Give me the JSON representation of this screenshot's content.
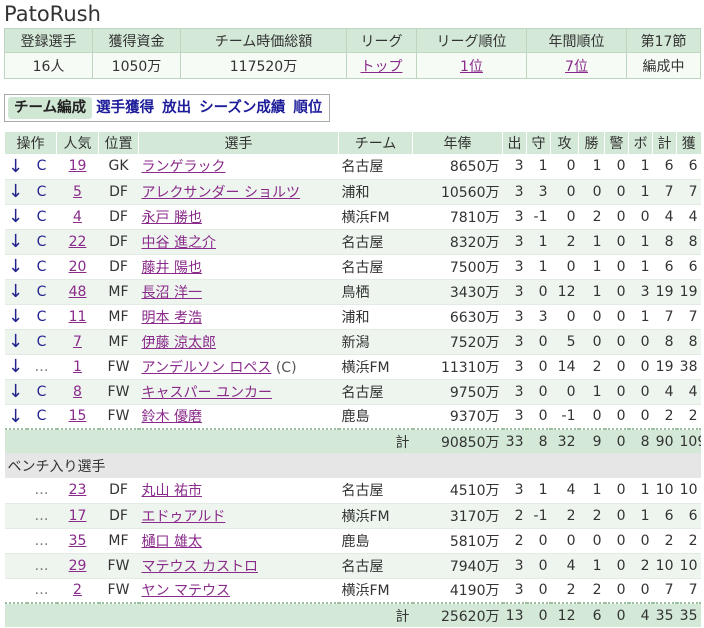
{
  "team": {
    "name": "PatoRush"
  },
  "summary": {
    "headers": [
      "登録選手",
      "獲得資金",
      "チーム時価総額",
      "リーグ",
      "リーグ順位",
      "年間順位",
      "第17節"
    ],
    "values": [
      "16人",
      "1050万",
      "117520万",
      "トップ",
      "1位",
      "7位",
      "編成中"
    ],
    "links": [
      false,
      false,
      false,
      true,
      true,
      true,
      false
    ]
  },
  "tabs": [
    "チーム編成",
    "選手獲得",
    "放出",
    "シーズン成績",
    "順位"
  ],
  "roster": {
    "headers": [
      "操作",
      "人気",
      "位置",
      "選手",
      "チーム",
      "年俸",
      "出",
      "守",
      "攻",
      "勝",
      "警",
      "ボ",
      "計",
      "獲"
    ],
    "starters": [
      {
        "ops": [
          "↓",
          "C"
        ],
        "pop": "19",
        "pos": "GK",
        "name": "ランゲラック",
        "cap": "",
        "team": "名古屋",
        "salary": "8650万",
        "s": [
          "3",
          "1",
          "0",
          "1",
          "0",
          "1",
          "6",
          "6"
        ]
      },
      {
        "ops": [
          "↓",
          "C"
        ],
        "pop": "5",
        "pos": "DF",
        "name": "アレクサンダー ショルツ",
        "cap": "",
        "team": "浦和",
        "salary": "10560万",
        "s": [
          "3",
          "3",
          "0",
          "0",
          "0",
          "1",
          "7",
          "7"
        ]
      },
      {
        "ops": [
          "↓",
          "C"
        ],
        "pop": "4",
        "pos": "DF",
        "name": "永戸 勝也",
        "cap": "",
        "team": "横浜FM",
        "salary": "7810万",
        "s": [
          "3",
          "-1",
          "0",
          "2",
          "0",
          "0",
          "4",
          "4"
        ]
      },
      {
        "ops": [
          "↓",
          "C"
        ],
        "pop": "22",
        "pos": "DF",
        "name": "中谷 進之介",
        "cap": "",
        "team": "名古屋",
        "salary": "8320万",
        "s": [
          "3",
          "1",
          "2",
          "1",
          "0",
          "1",
          "8",
          "8"
        ]
      },
      {
        "ops": [
          "↓",
          "C"
        ],
        "pop": "20",
        "pos": "DF",
        "name": "藤井 陽也",
        "cap": "",
        "team": "名古屋",
        "salary": "7500万",
        "s": [
          "3",
          "1",
          "0",
          "1",
          "0",
          "1",
          "6",
          "6"
        ]
      },
      {
        "ops": [
          "↓",
          "C"
        ],
        "pop": "48",
        "pos": "MF",
        "name": "長沼 洋一",
        "cap": "",
        "team": "鳥栖",
        "salary": "3430万",
        "s": [
          "3",
          "0",
          "12",
          "1",
          "0",
          "3",
          "19",
          "19"
        ]
      },
      {
        "ops": [
          "↓",
          "C"
        ],
        "pop": "11",
        "pos": "MF",
        "name": "明本 考浩",
        "cap": "",
        "team": "浦和",
        "salary": "6630万",
        "s": [
          "3",
          "3",
          "0",
          "0",
          "0",
          "1",
          "7",
          "7"
        ]
      },
      {
        "ops": [
          "↓",
          "C"
        ],
        "pop": "7",
        "pos": "MF",
        "name": "伊藤 涼太郎",
        "cap": "",
        "team": "新潟",
        "salary": "7520万",
        "s": [
          "3",
          "0",
          "5",
          "0",
          "0",
          "0",
          "8",
          "8"
        ]
      },
      {
        "ops": [
          "↓",
          "…"
        ],
        "pop": "1",
        "pos": "FW",
        "name": "アンデルソン ロペス",
        "cap": "(C)",
        "team": "横浜FM",
        "salary": "11310万",
        "s": [
          "3",
          "0",
          "14",
          "2",
          "0",
          "0",
          "19",
          "38"
        ]
      },
      {
        "ops": [
          "↓",
          "C"
        ],
        "pop": "8",
        "pos": "FW",
        "name": "キャスパー ユンカー",
        "cap": "",
        "team": "名古屋",
        "salary": "9750万",
        "s": [
          "3",
          "0",
          "0",
          "1",
          "0",
          "0",
          "4",
          "4"
        ]
      },
      {
        "ops": [
          "↓",
          "C"
        ],
        "pop": "15",
        "pos": "FW",
        "name": "鈴木 優磨",
        "cap": "",
        "team": "鹿島",
        "salary": "9370万",
        "s": [
          "3",
          "0",
          "-1",
          "0",
          "0",
          "0",
          "2",
          "2"
        ]
      }
    ],
    "starters_total": {
      "label": "計",
      "salary": "90850万",
      "s": [
        "33",
        "8",
        "32",
        "9",
        "0",
        "8",
        "90",
        "109"
      ]
    },
    "bench_label": "ベンチ入り選手",
    "bench": [
      {
        "ops": [
          "",
          "…"
        ],
        "pop": "23",
        "pos": "DF",
        "name": "丸山 祐市",
        "cap": "",
        "team": "名古屋",
        "salary": "4510万",
        "s": [
          "3",
          "1",
          "4",
          "1",
          "0",
          "1",
          "10",
          "10"
        ]
      },
      {
        "ops": [
          "",
          "…"
        ],
        "pop": "17",
        "pos": "DF",
        "name": "エドゥアルド",
        "cap": "",
        "team": "横浜FM",
        "salary": "3170万",
        "s": [
          "2",
          "-1",
          "2",
          "2",
          "0",
          "1",
          "6",
          "6"
        ]
      },
      {
        "ops": [
          "",
          "…"
        ],
        "pop": "35",
        "pos": "MF",
        "name": "樋口 雄太",
        "cap": "",
        "team": "鹿島",
        "salary": "5810万",
        "s": [
          "2",
          "0",
          "0",
          "0",
          "0",
          "0",
          "2",
          "2"
        ]
      },
      {
        "ops": [
          "",
          "…"
        ],
        "pop": "29",
        "pos": "FW",
        "name": "マテウス カストロ",
        "cap": "",
        "team": "名古屋",
        "salary": "7940万",
        "s": [
          "3",
          "0",
          "4",
          "1",
          "0",
          "2",
          "10",
          "10"
        ]
      },
      {
        "ops": [
          "",
          "…"
        ],
        "pop": "2",
        "pos": "FW",
        "name": "ヤン マテウス",
        "cap": "",
        "team": "横浜FM",
        "salary": "4190万",
        "s": [
          "3",
          "0",
          "2",
          "2",
          "0",
          "0",
          "7",
          "7"
        ]
      }
    ],
    "bench_total": {
      "label": "計",
      "salary": "25620万",
      "s": [
        "13",
        "0",
        "12",
        "6",
        "0",
        "4",
        "35",
        "35"
      ]
    }
  },
  "colors": {
    "header_bg": "#d3e8d6",
    "link": "#8a2a8a",
    "tab_text": "#1d1d9a",
    "stripe": "#eef5ef"
  }
}
